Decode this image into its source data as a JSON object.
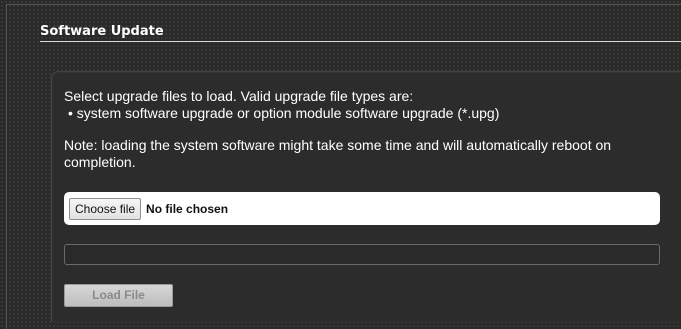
{
  "section": {
    "title": "Software Update"
  },
  "instructions": {
    "intro": "Select upgrade files to load. Valid upgrade file types are:",
    "file_type_bullet": "• system software upgrade or option module software upgrade (*.upg)",
    "note": "Note: loading the system software might take some time and will automatically reboot on completion."
  },
  "file_input": {
    "button_label": "Choose file",
    "status": "No file chosen"
  },
  "progress": {
    "percent": 0
  },
  "actions": {
    "load_label": "Load File",
    "load_enabled": false
  }
}
